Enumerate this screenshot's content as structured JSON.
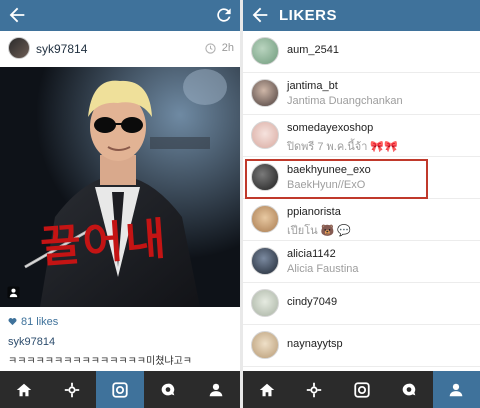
{
  "left_screen": {
    "header": {
      "back_icon": "arrow-left-icon",
      "refresh_icon": "refresh-icon",
      "bar_color": "#3f729b"
    },
    "post": {
      "username": "syk97814",
      "time": "2h",
      "overlay_text": "끌어내",
      "likes": "81 likes",
      "caption_user": "syk97814",
      "caption_text": "ㅋㅋㅋㅋㅋㅋㅋㅋㅋㅋㅋㅋㅋㅋㅋ미쳤냐고ㅋ"
    }
  },
  "right_screen": {
    "header": {
      "title": "LIKERS",
      "back_icon": "arrow-left-icon"
    },
    "likers": [
      {
        "username": "aum_2541",
        "fullname": "",
        "avatar_color": "#8fb39a"
      },
      {
        "username": "jantima_bt",
        "fullname": "Jantima Duangchankan",
        "avatar_color": "#6b5d5a"
      },
      {
        "username": "somedayexoshop",
        "fullname": "ปิดพรี 7 พ.ค.นี้จ้า 🎀🎀",
        "avatar_color": "#e6c7c1"
      },
      {
        "username": "baekhyunee_exo",
        "fullname": "BaekHyun//ExO",
        "avatar_color": "#3a3a3a"
      },
      {
        "username": "ppianorista",
        "fullname": "เปียโน 🐻 💬",
        "avatar_color": "#c9a075"
      },
      {
        "username": "alicia1142",
        "fullname": "Alicia Faustina",
        "avatar_color": "#2f3b4a"
      },
      {
        "username": "cindy7049",
        "fullname": "",
        "avatar_color": "#c8cfc3"
      },
      {
        "username": "naynayytsp",
        "fullname": "",
        "avatar_color": "#d2c0a5"
      }
    ],
    "highlight_color": "#c0392b"
  },
  "bottom_nav": {
    "items": [
      "home-icon",
      "explore-icon",
      "camera-icon",
      "activity-icon",
      "profile-icon"
    ]
  },
  "colors": {
    "brand": "#3f729b",
    "nav_bg": "#2b2b2b"
  }
}
